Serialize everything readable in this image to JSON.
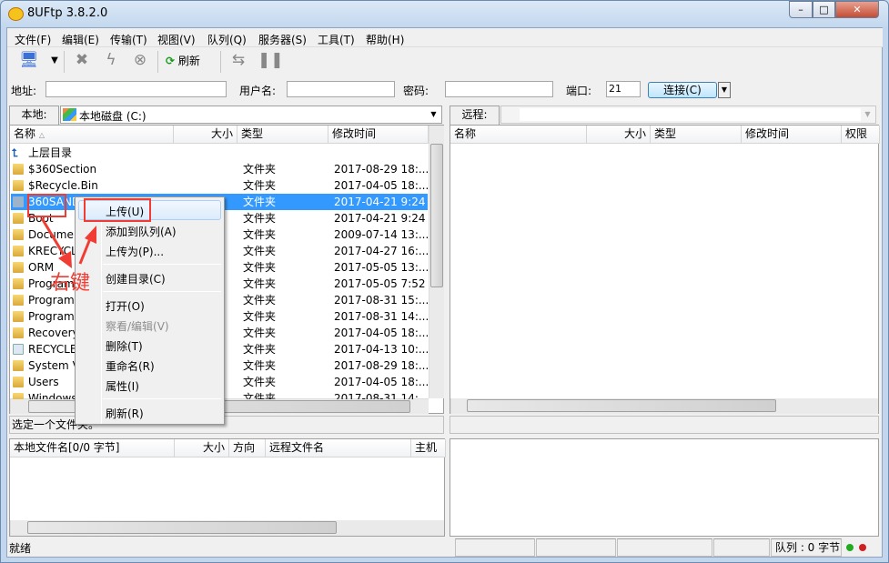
{
  "app": {
    "title": "8UFtp 3.8.2.0",
    "icon": "ftp-smiley-icon",
    "window_buttons": [
      "minimize",
      "maximize",
      "close"
    ]
  },
  "menu": [
    "文件(F)",
    "编辑(E)",
    "传输(T)",
    "视图(V)",
    "队列(Q)",
    "服务器(S)",
    "工具(T)",
    "帮助(H)"
  ],
  "toolbar": {
    "refresh_label": "刷新"
  },
  "connection": {
    "address_label": "地址:",
    "address_value": "",
    "user_label": "用户名:",
    "user_value": "",
    "password_label": "密码:",
    "password_value": "",
    "port_label": "端口:",
    "port_value": "21",
    "connect_label": "连接(C)"
  },
  "local": {
    "tab": "本地:",
    "path": "本地磁盘 (C:)",
    "columns": [
      "名称",
      "大小",
      "类型",
      "修改时间"
    ],
    "rows": [
      {
        "name": "上层目录",
        "type": "",
        "date": "",
        "icon": "up-dir-icon"
      },
      {
        "name": "$360Section",
        "type": "文件夹",
        "date": "2017-08-29 18:..."
      },
      {
        "name": "$Recycle.Bin",
        "type": "文件夹",
        "date": "2017-04-05 18:..."
      },
      {
        "name": "360SAND",
        "type": "文件夹",
        "date": "2017-04-21 9:24",
        "selected": true
      },
      {
        "name": "Boot",
        "type": "文件夹",
        "date": "2017-04-21 9:24"
      },
      {
        "name": "Docume",
        "type": "文件夹",
        "date": "2009-07-14 13:..."
      },
      {
        "name": "KRECYCL",
        "type": "文件夹",
        "date": "2017-04-27 16:..."
      },
      {
        "name": "ORM",
        "type": "文件夹",
        "date": "2017-05-05 13:..."
      },
      {
        "name": "Program",
        "type": "文件夹",
        "date": "2017-05-05 7:52"
      },
      {
        "name": "Program",
        "type": "文件夹",
        "date": "2017-08-31 15:..."
      },
      {
        "name": "Program",
        "type": "文件夹",
        "date": "2017-08-31 14:..."
      },
      {
        "name": "Recovery",
        "type": "文件夹",
        "date": "2017-04-05 18:..."
      },
      {
        "name": "RECYCLE",
        "type": "文件夹",
        "date": "2017-04-13 10:..."
      },
      {
        "name": "System V",
        "type": "文件夹",
        "date": "2017-08-29 18:..."
      },
      {
        "name": "Users",
        "type": "文件夹",
        "date": "2017-04-05 18:..."
      },
      {
        "name": "Windows",
        "type": "文件夹",
        "date": "2017-08-31 14:..."
      }
    ],
    "status": "选定一个文件夹。"
  },
  "remote": {
    "tab": "远程:",
    "path": "",
    "columns": [
      "名称",
      "大小",
      "类型",
      "修改时间",
      "权限"
    ]
  },
  "queue": {
    "columns": [
      "本地文件名[0/0 字节]",
      "大小",
      "方向",
      "远程文件名",
      "主机"
    ]
  },
  "context_menu": [
    {
      "label": "上传(U)",
      "highlighted": true
    },
    {
      "label": "添加到队列(A)"
    },
    {
      "label": "上传为(P)..."
    },
    {
      "sep": true
    },
    {
      "label": "创建目录(C)"
    },
    {
      "sep": true
    },
    {
      "label": "打开(O)"
    },
    {
      "label": "察看/编辑(V)",
      "disabled": true
    },
    {
      "label": "删除(T)"
    },
    {
      "label": "重命名(R)"
    },
    {
      "label": "属性(I)"
    },
    {
      "sep": true
    },
    {
      "label": "刷新(R)"
    }
  ],
  "annotation": {
    "text": "右键",
    "color": "#f03c32"
  },
  "statusbar": {
    "left": "就绪",
    "queue": "队列 : 0 字节"
  }
}
